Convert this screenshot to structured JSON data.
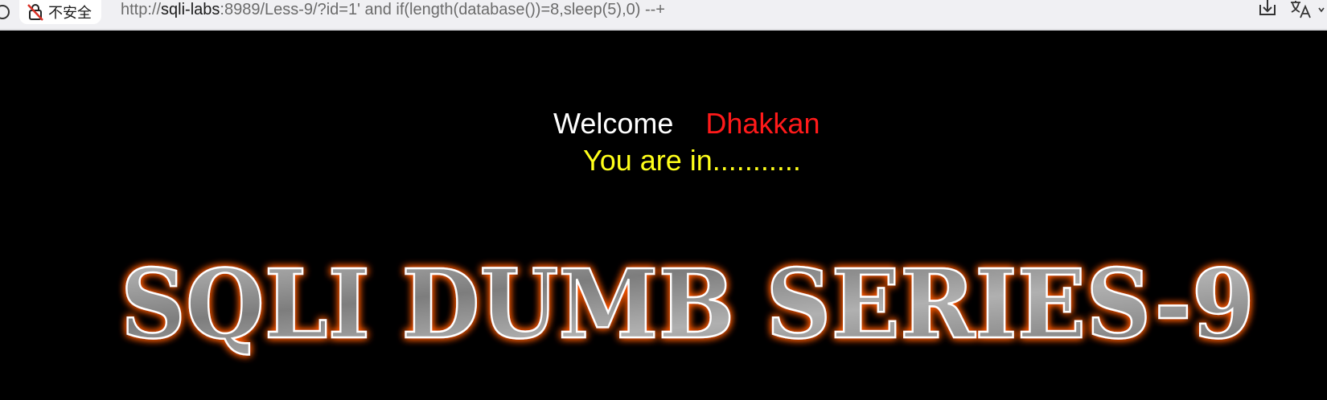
{
  "browser": {
    "security_label": "不安全",
    "url_scheme": "http://",
    "url_host": "sqli-labs",
    "url_rest": ":8989/Less-9/?id=1' and if(length(database())=8,sleep(5),0) --+",
    "icons": [
      "reload-icon",
      "not-secure-lock-icon",
      "download-icon",
      "translate-icon",
      "chevron-down-icon"
    ]
  },
  "page": {
    "welcome": "Welcome",
    "user": "Dhakkan",
    "status": "You are in...........",
    "banner": "SQLI DUMB SERIES-9",
    "colors": {
      "background": "#000000",
      "welcome": "#ffffff",
      "user": "#ff1a1a",
      "status": "#ffff1a",
      "banner_glow": "#ff5a00",
      "banner_metal": "#9a9a9a"
    }
  }
}
